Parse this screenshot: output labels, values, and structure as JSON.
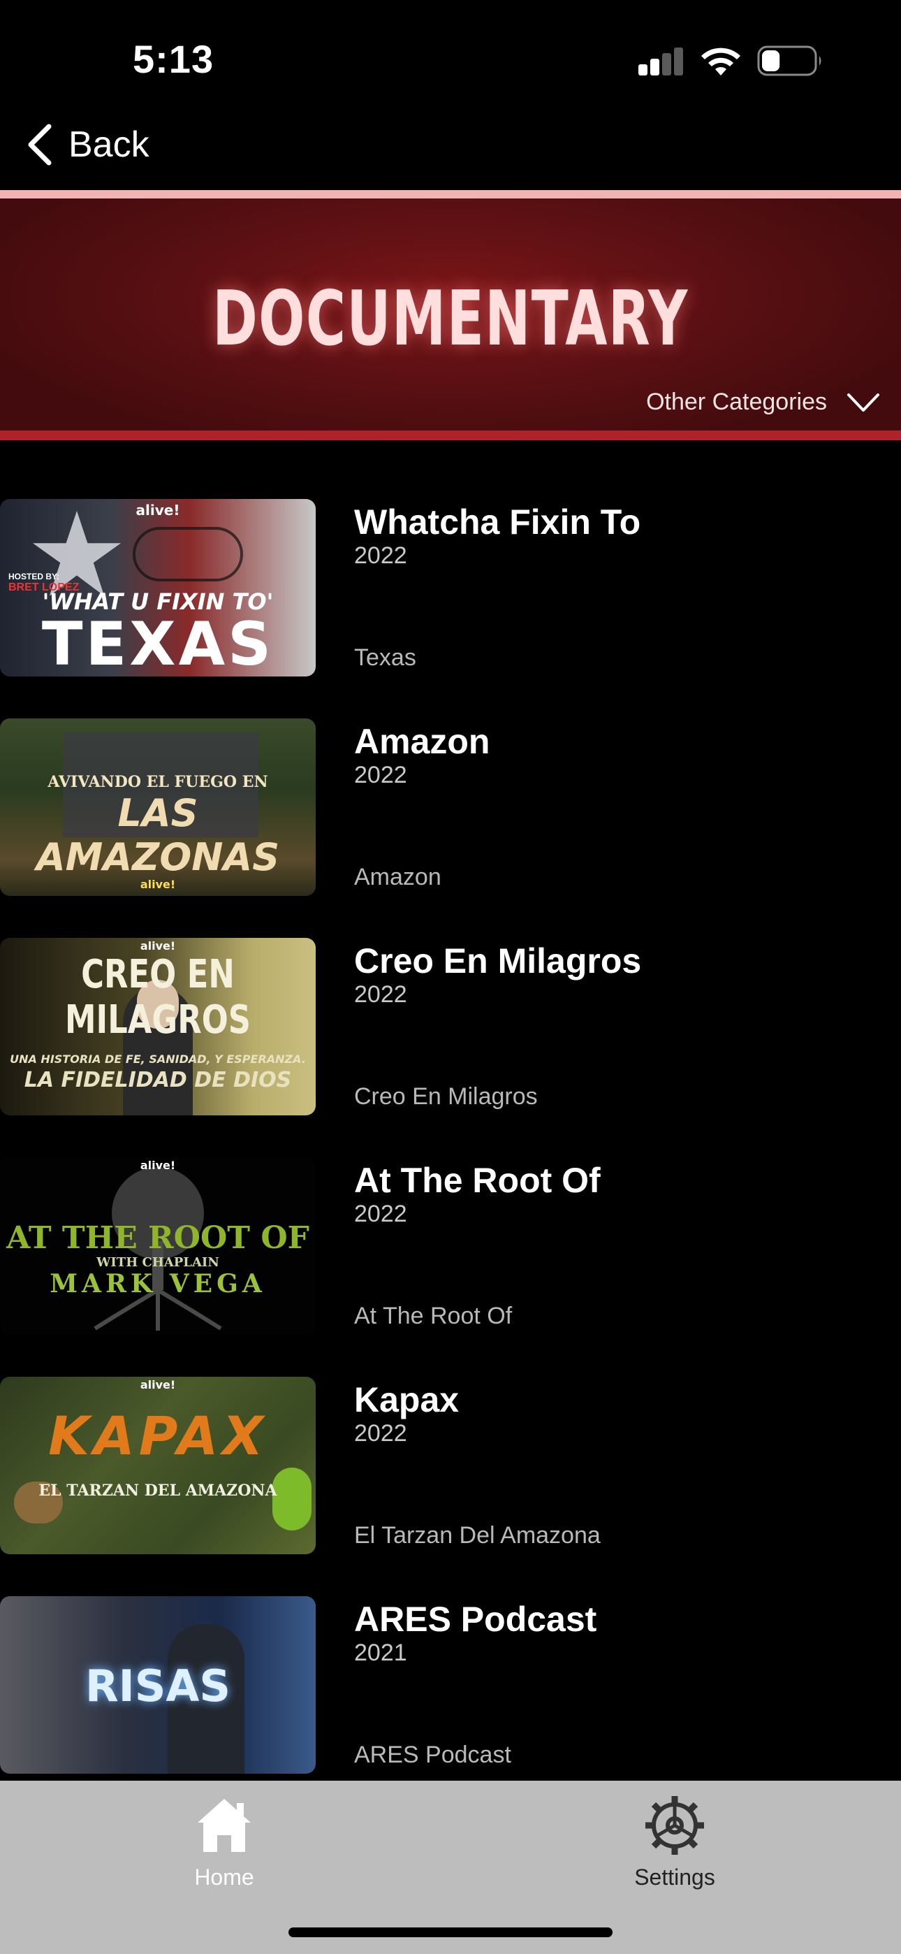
{
  "status_bar": {
    "time": "5:13",
    "battery_level": 0.35
  },
  "nav": {
    "back_label": "Back"
  },
  "header": {
    "title": "DOCUMENTARY",
    "other_categories_label": "Other Categories",
    "accent_color": "#5a1013",
    "line_color": "#b0222a"
  },
  "items": [
    {
      "title": "Whatcha Fixin To",
      "year": "2022",
      "subtitle": "Texas",
      "thumb": {
        "badge": "alive!",
        "lines": [
          "'WHAT U FIXIN TO'",
          "TEXAS"
        ],
        "host_label": "HOSTED BY:",
        "host_name": "BRET LOPEZ"
      }
    },
    {
      "title": "Amazon",
      "year": "2022",
      "subtitle": "Amazon",
      "thumb": {
        "badge": "alive!",
        "lines": [
          "AVIVANDO EL FUEGO EN",
          "LAS AMAZONAS"
        ]
      }
    },
    {
      "title": "Creo En Milagros",
      "year": "2022",
      "subtitle": "Creo En Milagros",
      "thumb": {
        "badge": "alive!",
        "lines": [
          "CREO EN MILAGROS",
          "UNA HISTORIA DE FE, SANIDAD, Y ESPERANZA.",
          "LA FIDELIDAD DE DIOS"
        ]
      }
    },
    {
      "title": "At The Root Of",
      "year": "2022",
      "subtitle": "At The Root Of",
      "thumb": {
        "badge": "alive!",
        "lines": [
          "AT THE ROOT OF",
          "WITH CHAPLAIN",
          "MARK VEGA"
        ]
      }
    },
    {
      "title": "Kapax",
      "year": "2022",
      "subtitle": "El Tarzan Del Amazona",
      "thumb": {
        "badge": "alive!",
        "lines": [
          "KAPAX",
          "EL TARZAN DEL AMAZONA"
        ]
      }
    },
    {
      "title": "ARES Podcast",
      "year": "2021",
      "subtitle": "ARES Podcast",
      "thumb": {
        "lines": [
          "RISAS"
        ]
      }
    }
  ],
  "tab_bar": {
    "tabs": [
      {
        "label": "Home",
        "icon": "house-icon",
        "active": true
      },
      {
        "label": "Settings",
        "icon": "gear-icon",
        "active": false
      }
    ]
  }
}
